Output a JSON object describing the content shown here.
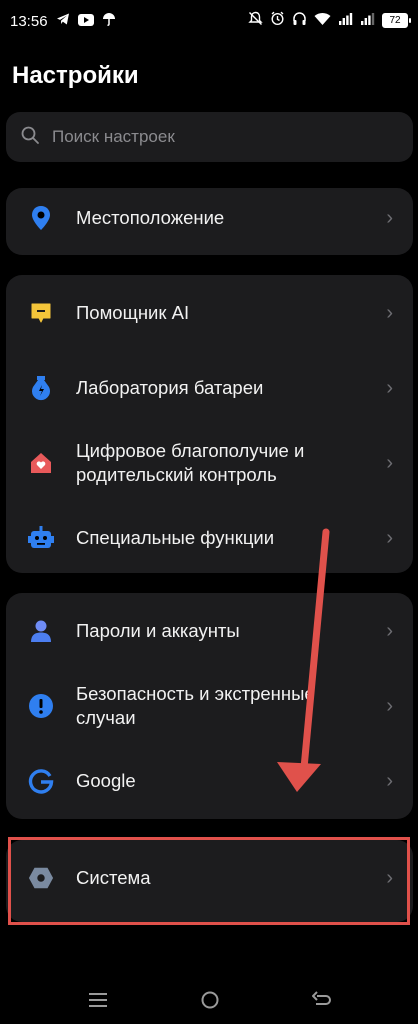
{
  "status_bar": {
    "time": "13:56",
    "battery": "72"
  },
  "header": {
    "title": "Настройки"
  },
  "search": {
    "placeholder": "Поиск настроек"
  },
  "groups": [
    {
      "items": [
        {
          "label": "Местоположение",
          "icon": "location-icon",
          "color": "#2f7ff0"
        }
      ]
    },
    {
      "items": [
        {
          "label": "Помощник AI",
          "icon": "ai-assistant-icon",
          "color": "#f4c53a"
        },
        {
          "label": "Лаборатория батареи",
          "icon": "battery-lab-icon",
          "color": "#2f7ff0"
        },
        {
          "label": "Цифровое благополучие и родительский контроль",
          "icon": "digital-wellbeing-icon",
          "color": "#e8595a"
        },
        {
          "label": "Специальные функции",
          "icon": "accessibility-icon",
          "color": "#2f7ff0"
        }
      ]
    },
    {
      "items": [
        {
          "label": "Пароли и аккаунты",
          "icon": "accounts-icon",
          "color": "#4c7ef0"
        },
        {
          "label": "Безопасность и экстренные случаи",
          "icon": "emergency-icon",
          "color": "#2f7ff0"
        },
        {
          "label": "Google",
          "icon": "google-icon",
          "color": "#2f7ff0"
        }
      ]
    },
    {
      "items": [
        {
          "label": "Система",
          "icon": "system-icon",
          "color": "#7a8aa0"
        }
      ]
    }
  ],
  "annotation_color": "#e0514b"
}
